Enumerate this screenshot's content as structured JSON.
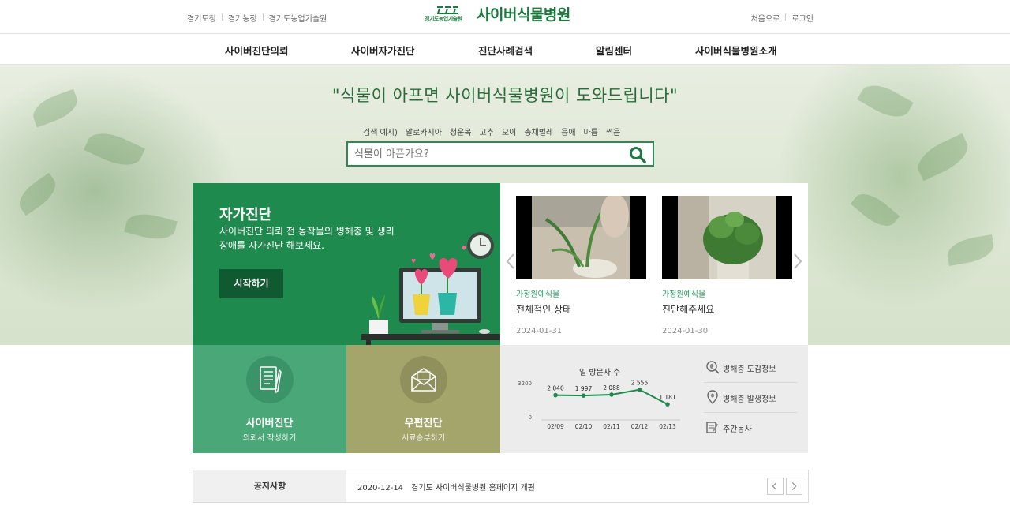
{
  "top": {
    "links": [
      "경기도청",
      "경기농정",
      "경기도농업기술원"
    ],
    "logo_org": "경기도농업기술원",
    "site_title": "사이버식물병원",
    "user_links": [
      "처음으로",
      "로그인"
    ]
  },
  "nav": {
    "items": [
      "사이버진단의뢰",
      "사이버자가진단",
      "진단사례검색",
      "알림센터",
      "사이버식물병원소개"
    ]
  },
  "hero": {
    "title": "\"식물이 아프면 사이버식물병원이 도와드립니다\"",
    "suggest_label": "검색 예시)",
    "suggest_terms": [
      "알로카시아",
      "청운목",
      "고추",
      "오이",
      "총채벌레",
      "응애",
      "마름",
      "썩음"
    ],
    "search_placeholder": "식물이 아픈가요?"
  },
  "self_diag": {
    "title": "자가진단",
    "desc": "사이버진단 의뢰 전 농작물의 병해충 및 생리장애를 자가진단 해보세요.",
    "button": "시작하기"
  },
  "videos": [
    {
      "category": "가정원예식물",
      "title": "전체적인 상태",
      "date": "2024-01-31"
    },
    {
      "category": "가정원예식물",
      "title": "진단해주세요",
      "date": "2024-01-30"
    }
  ],
  "tiles": [
    {
      "title": "사이버진단",
      "sub": "의뢰서 작성하기",
      "color": "#4aa878"
    },
    {
      "title": "우편진단",
      "sub": "시료송부하기",
      "color": "#a4a56a"
    }
  ],
  "visitors": {
    "title": "일 방문자 수",
    "quick_links": [
      "병해충 도감정보",
      "병해충 발생정보",
      "주간농사"
    ]
  },
  "chart_data": {
    "type": "line",
    "title": "일 방문자 수",
    "categories": [
      "02/09",
      "02/10",
      "02/11",
      "02/12",
      "02/13"
    ],
    "values": [
      2040,
      1997,
      2088,
      2555,
      1181
    ],
    "value_labels": [
      "2 040",
      "1 997",
      "2 088",
      "2 555",
      "1 181"
    ],
    "y_ticks": [
      "3200",
      "0"
    ],
    "ylim": [
      0,
      3200
    ],
    "color": "#1f8a4c"
  },
  "notice": {
    "label": "공지사항",
    "date": "2020-12-14",
    "text": "경기도 사이버식물병원 홈페이지 개편"
  }
}
